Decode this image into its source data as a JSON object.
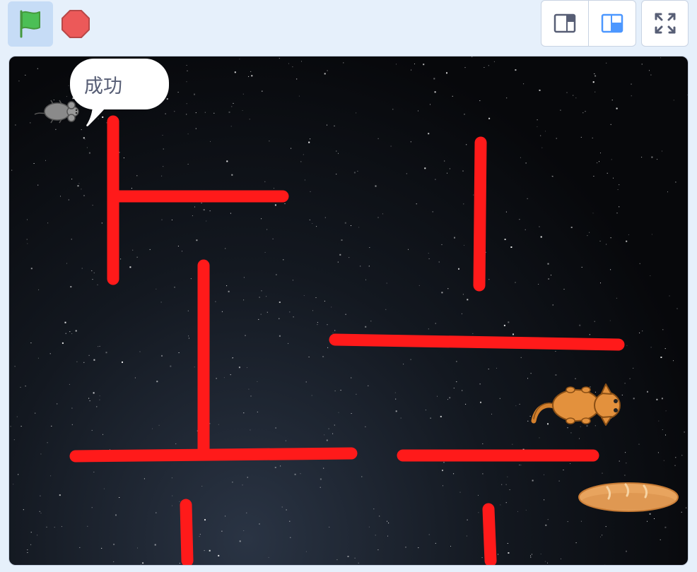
{
  "toolbar": {
    "green_flag_icon": "green-flag-icon",
    "stop_icon": "stop-icon",
    "small_stage_icon": "small-stage-icon",
    "normal_stage_icon": "normal-stage-icon",
    "fullscreen_icon": "fullscreen-icon"
  },
  "stage": {
    "speech_bubble_text": "成功",
    "sprites": [
      "mouse",
      "cat",
      "bread"
    ]
  },
  "colors": {
    "toolbar_bg": "#e6f0fb",
    "flag_green": "#4cbf56",
    "stop_red": "#ec5959",
    "accent_blue": "#4c97ff",
    "wall_red": "#ff1a1a",
    "bubble_text": "#575e75"
  }
}
